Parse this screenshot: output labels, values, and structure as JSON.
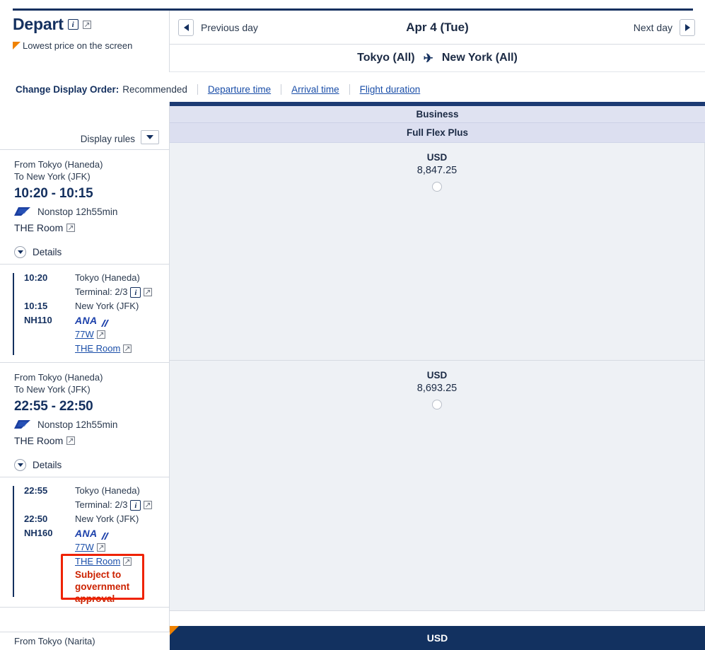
{
  "brand": {
    "title": "Depart",
    "info_icon": "info-icon",
    "external_icon": "external-link-icon",
    "lowest_price_note": "Lowest price on the screen"
  },
  "daynav": {
    "previous_label": "Previous day",
    "next_label": "Next day",
    "date": "Apr 4 (Tue)",
    "prev_icon": "triangle-left-icon",
    "next_icon": "triangle-right-icon"
  },
  "route": {
    "origin": "Tokyo (All)",
    "destination": "New York (All)",
    "plane_icon": "✈"
  },
  "sortbar": {
    "label": "Change Display Order:",
    "current": "Recommended",
    "links": [
      "Departure time",
      "Arrival time",
      "Flight duration"
    ]
  },
  "display_rules": {
    "label": "Display rules",
    "caret_icon": "chevron-down-icon"
  },
  "column": {
    "cabin": "Business",
    "fare": "Full Flex Plus"
  },
  "flights": [
    {
      "from": "From Tokyo (Haneda)",
      "to": "To New York (JFK)",
      "times": "10:20 - 10:15",
      "stops": "Nonstop 12h55min",
      "cabin_product": "THE Room",
      "details_label": "Details",
      "details": {
        "dep_time": "10:20",
        "dep_place": "Tokyo (Haneda)",
        "terminal": "Terminal: 2/3",
        "arr_time": "10:15",
        "arr_place": "New York (JFK)",
        "flight_no": "NH110",
        "carrier": "ANA",
        "aircraft": "77W",
        "product": "THE Room"
      },
      "price": {
        "currency": "USD",
        "amount": "8,847.25"
      }
    },
    {
      "from": "From Tokyo (Haneda)",
      "to": "To New York (JFK)",
      "times": "22:55 - 22:50",
      "stops": "Nonstop 12h55min",
      "cabin_product": "THE Room",
      "details_label": "Details",
      "details": {
        "dep_time": "22:55",
        "dep_place": "Tokyo (Haneda)",
        "terminal": "Terminal: 2/3",
        "arr_time": "22:50",
        "arr_place": "New York (JFK)",
        "flight_no": "NH160",
        "carrier": "ANA",
        "aircraft": "77W",
        "product": "THE Room",
        "warning": "Subject to government approval"
      },
      "price": {
        "currency": "USD",
        "amount": "8,693.25"
      }
    }
  ],
  "third_flight_partial": {
    "from": "From Tokyo (Narita)"
  },
  "bottom_bar": {
    "currency": "USD",
    "flag_icon": "lowest-price-flag-icon"
  },
  "colors": {
    "navy": "#14305f",
    "header_navy": "#1c3a73",
    "link_blue": "#1a4ea8",
    "orange_flag": "#ef8200",
    "warning_red": "#cc2200",
    "warning_border": "#ef2200",
    "cabin_band": "#dfe2f1",
    "fare_band": "#dcdff0",
    "cell_bg": "#eef1f5"
  }
}
